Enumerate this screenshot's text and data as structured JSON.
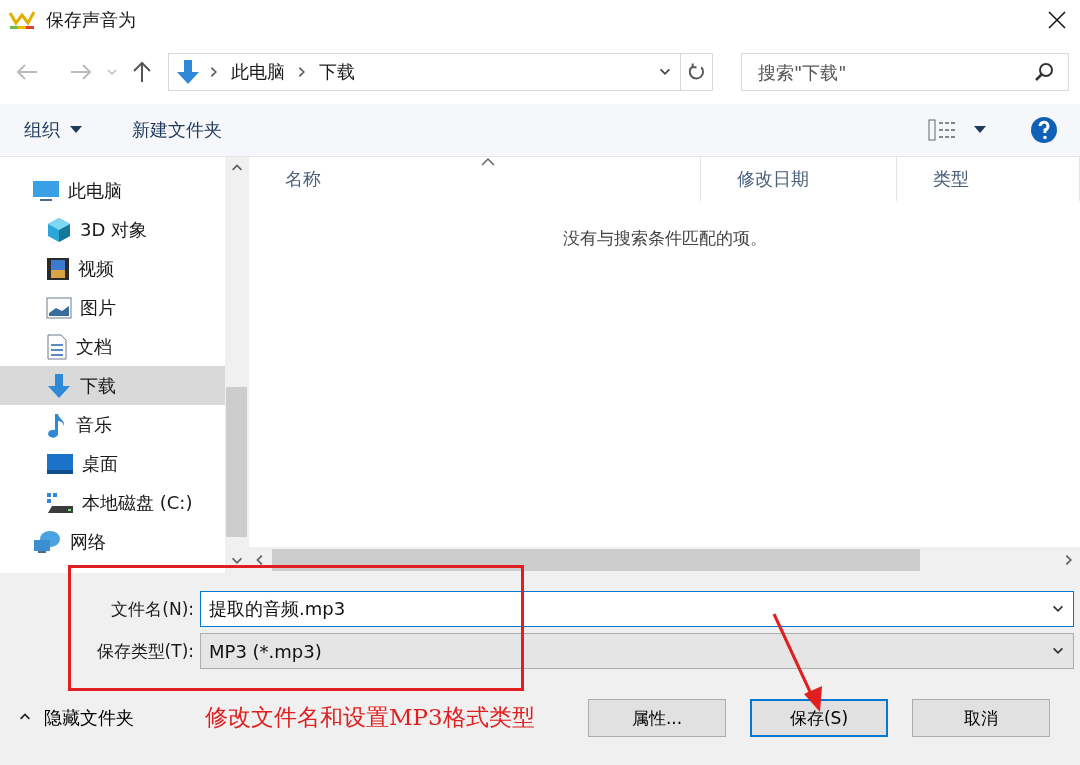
{
  "window": {
    "title": "保存声音为"
  },
  "navigation": {
    "breadcrumb": [
      "此电脑",
      "下载"
    ],
    "search": {
      "placeholder": "搜索\"下载\""
    }
  },
  "toolbar": {
    "organize": "组织",
    "new_folder": "新建文件夹"
  },
  "sidebar": {
    "items": [
      {
        "label": "此电脑",
        "kind": "computer",
        "selected": false,
        "children": [
          {
            "label": "3D 对象",
            "kind": "cube",
            "selected": false
          },
          {
            "label": "视频",
            "kind": "video",
            "selected": false
          },
          {
            "label": "图片",
            "kind": "pictures",
            "selected": false
          },
          {
            "label": "文档",
            "kind": "documents",
            "selected": false
          },
          {
            "label": "下载",
            "kind": "downloads",
            "selected": true
          },
          {
            "label": "音乐",
            "kind": "music",
            "selected": false
          },
          {
            "label": "桌面",
            "kind": "desktop",
            "selected": false
          },
          {
            "label": "本地磁盘 (C:)",
            "kind": "disk",
            "selected": false
          }
        ]
      },
      {
        "label": "网络",
        "kind": "network",
        "selected": false
      }
    ]
  },
  "file_list": {
    "columns": [
      {
        "label": "名称",
        "sorted": true
      },
      {
        "label": "修改日期",
        "sorted": false
      },
      {
        "label": "类型",
        "sorted": false
      }
    ],
    "empty_message": "没有与搜索条件匹配的项。"
  },
  "form": {
    "file_name": {
      "label": "文件名(N):",
      "value": "提取的音频.mp3"
    },
    "file_type": {
      "label": "保存类型(T):",
      "value": "MP3 (*.mp3)"
    }
  },
  "hide_folders": "隐藏文件夹",
  "buttons": [
    {
      "label": "属性...",
      "default": false
    },
    {
      "label": "保存(S)",
      "default": true
    },
    {
      "label": "取消",
      "default": false
    }
  ],
  "annotation": {
    "text": "修改文件名和设置MP3格式类型"
  }
}
